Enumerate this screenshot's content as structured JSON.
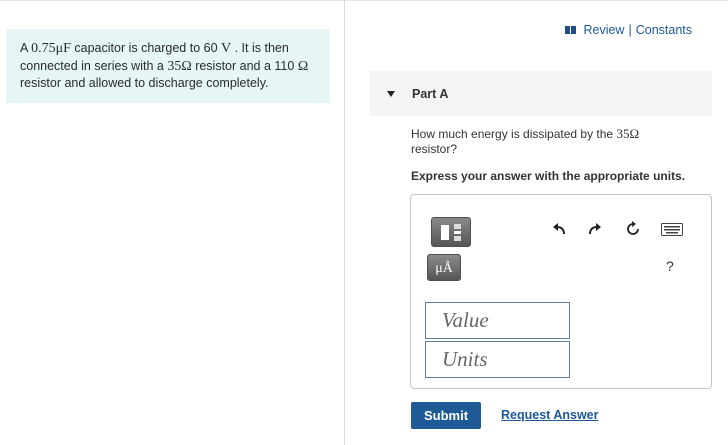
{
  "problem": {
    "prefix": "A ",
    "capacitance": "0.75μF",
    "text1": " capacitor is charged to 60 ",
    "volt_unit": "V",
    "text2": " . It is then connected in series with a ",
    "resistance": "35Ω",
    "text3": " resistor and a 110 ",
    "ohm": "Ω",
    "text4": " resistor and allowed to discharge completely."
  },
  "top_links": {
    "review": "Review",
    "separator": "|",
    "constants": "Constants"
  },
  "part": {
    "title": "Part A",
    "question_text": "How much energy is dissipated by the ",
    "question_resistance": "35Ω",
    "question_end": " resistor?",
    "instruction": "Express your answer with the appropriate units."
  },
  "toolbar": {
    "unit_label": "μÅ",
    "help_label": "?"
  },
  "inputs": {
    "value_placeholder": "Value",
    "units_placeholder": "Units"
  },
  "buttons": {
    "submit": "Submit",
    "request_answer": "Request Answer"
  },
  "colors": {
    "accent": "#1d5a96",
    "problem_bg": "#e6f6f6",
    "header_bg": "#f3f4f5"
  }
}
